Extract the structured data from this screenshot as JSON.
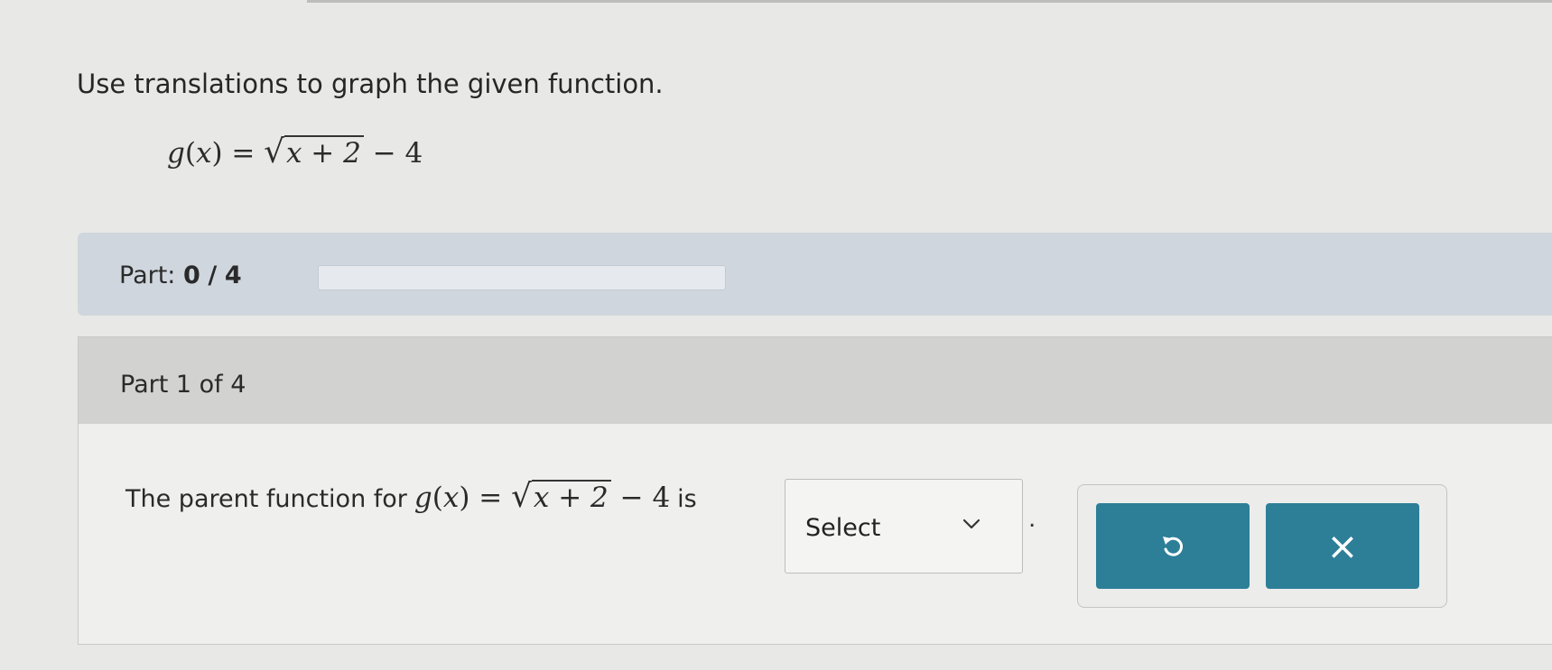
{
  "prompt": "Use translations to graph the given function.",
  "function": {
    "lhs_name": "g",
    "lhs_var": "x",
    "radicand": "x + 2",
    "tail": "− 4"
  },
  "progress": {
    "label": "Part:",
    "current": "0",
    "separator": "/",
    "total": "4",
    "fraction_complete": 0
  },
  "part": {
    "header": "Part 1 of 4",
    "question_prefix": "The parent function for",
    "question_is": "is",
    "question_end": "."
  },
  "select": {
    "value": "Select",
    "icon": "chevron-down-icon"
  },
  "buttons": {
    "undo_icon": "undo-icon",
    "clear_icon": "close-icon",
    "clear_glyph": "×",
    "color": "#2d7f98"
  }
}
